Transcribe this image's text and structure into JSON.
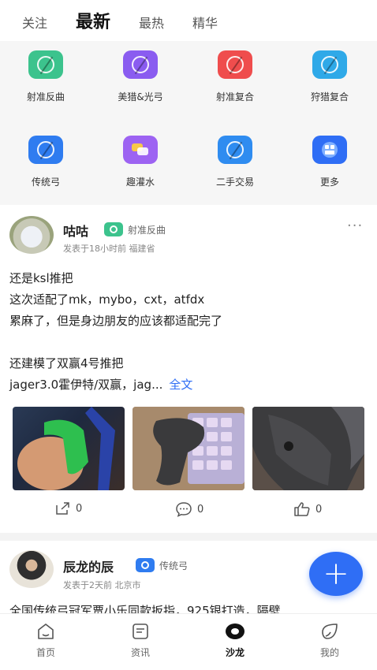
{
  "tabs": [
    {
      "label": "关注",
      "active": false
    },
    {
      "label": "最新",
      "active": true
    },
    {
      "label": "最热",
      "active": false
    },
    {
      "label": "精华",
      "active": false
    }
  ],
  "categories": [
    {
      "label": "射准反曲",
      "icon": "recurve-bow-icon",
      "color": "#3cc38d"
    },
    {
      "label": "美猎&光弓",
      "icon": "hunting-bow-icon",
      "color": "#8a5cf0"
    },
    {
      "label": "射准复合",
      "icon": "compound-bow-icon",
      "color": "#ef4d4d"
    },
    {
      "label": "狩猎复合",
      "icon": "hunting-compound-icon",
      "color": "#2fa9e8"
    },
    {
      "label": "传统弓",
      "icon": "traditional-bow-icon",
      "color": "#2f7cf0"
    },
    {
      "label": "趣灌水",
      "icon": "chat-bubble-icon",
      "color": "#9d63f2"
    },
    {
      "label": "二手交易",
      "icon": "trade-icon",
      "color": "#2f8cf0"
    },
    {
      "label": "更多",
      "icon": "more-grid-icon",
      "color": "#2f6ef5"
    }
  ],
  "post1": {
    "username": "咕咕",
    "category_badge": "射准反曲",
    "badge_color": "#3cc38d",
    "meta": "发表于18小时前  福建省",
    "more": "···",
    "lines": [
      "还是ksl推把",
      "这次适配了mk，mybo，cxt，atfdx",
      "累麻了，但是身边朋友的应该都适配完了",
      "",
      "还建模了双赢4号推把"
    ],
    "last_line": "jager3.0霍伊特/双赢，jag...",
    "full_text_link": "全文",
    "share_count": "0",
    "comment_count": "0",
    "like_count": "0"
  },
  "post2": {
    "username": "辰龙的辰",
    "category_badge": "传统弓",
    "badge_color": "#2f7cf0",
    "meta": "发表于2天前  北京市",
    "first_line": "全国传统弓冠军贾小乐同款扳指，925银打造，隔壁"
  },
  "fab_label": "+",
  "bottom_nav": [
    {
      "label": "首页",
      "icon": "home-icon",
      "active": false
    },
    {
      "label": "资讯",
      "icon": "news-icon",
      "active": false
    },
    {
      "label": "沙龙",
      "icon": "salon-icon",
      "active": true
    },
    {
      "label": "我的",
      "icon": "profile-icon",
      "active": false
    }
  ]
}
